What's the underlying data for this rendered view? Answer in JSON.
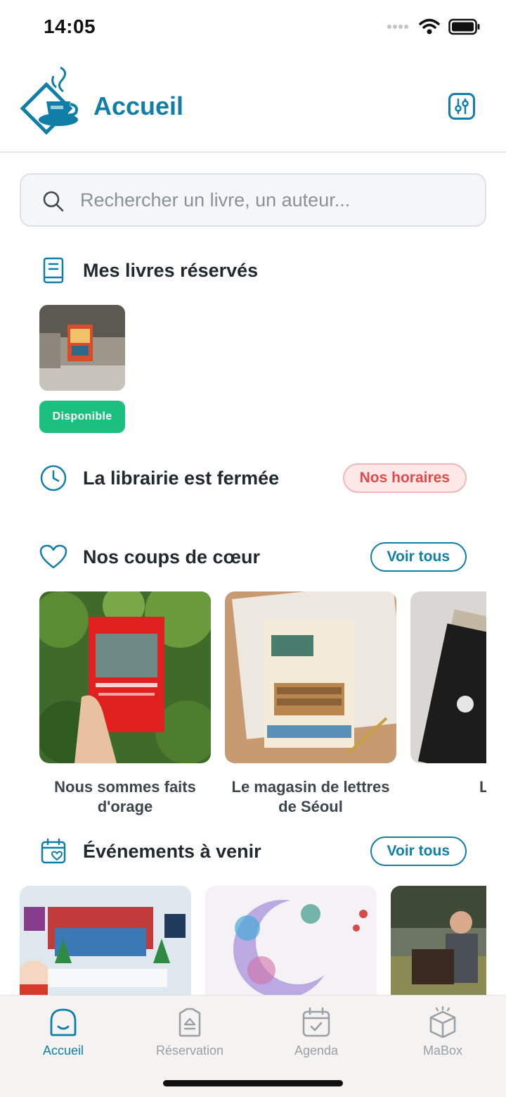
{
  "status": {
    "time": "14:05"
  },
  "header": {
    "title": "Accueil",
    "filter_icon": "filter-settings-icon"
  },
  "search": {
    "placeholder": "Rechercher un livre, un auteur..."
  },
  "reserved": {
    "title": "Mes livres réservés",
    "icon": "book-icon",
    "items": [
      {
        "status": "Disponible"
      }
    ]
  },
  "hours": {
    "title": "La librairie est fermée",
    "icon": "clock-icon",
    "button": "Nos horaires"
  },
  "favorites": {
    "title": "Nos coups de cœur",
    "icon": "heart-icon",
    "see_all": "Voir tous",
    "books": [
      {
        "title": "Nous sommes faits d'orage"
      },
      {
        "title": "Le magasin de lettres de Séoul"
      },
      {
        "title": "L'An"
      }
    ]
  },
  "events": {
    "title": "Événements à venir",
    "icon": "calendar-heart-icon",
    "see_all": "Voir tous"
  },
  "tabs": [
    {
      "label": "Accueil",
      "icon": "home-icon",
      "active": true
    },
    {
      "label": "Réservation",
      "icon": "reservation-icon",
      "active": false
    },
    {
      "label": "Agenda",
      "icon": "calendar-check-icon",
      "active": false
    },
    {
      "label": "MaBox",
      "icon": "box-icon",
      "active": false
    }
  ],
  "colors": {
    "brand": "#0f7fa8",
    "available": "#1bbf7e",
    "closed_text": "#e24a4a",
    "closed_bg": "#fde8e8"
  }
}
